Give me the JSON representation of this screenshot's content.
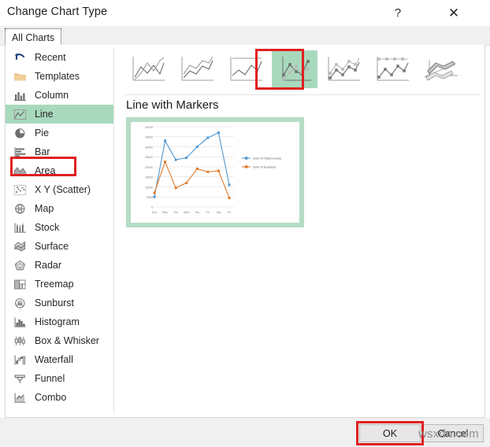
{
  "window": {
    "title": "Change Chart Type",
    "help_label": "?",
    "close_label": "✕"
  },
  "tabs": [
    {
      "label": "All Charts",
      "active": true
    }
  ],
  "sidebar": {
    "items": [
      {
        "label": "Recent",
        "icon": "undo-arrow-icon",
        "selected": false
      },
      {
        "label": "Templates",
        "icon": "folder-icon",
        "selected": false
      },
      {
        "label": "Column",
        "icon": "column-chart-icon",
        "selected": false
      },
      {
        "label": "Line",
        "icon": "line-chart-icon",
        "selected": true
      },
      {
        "label": "Pie",
        "icon": "pie-chart-icon",
        "selected": false
      },
      {
        "label": "Bar",
        "icon": "bar-chart-icon",
        "selected": false
      },
      {
        "label": "Area",
        "icon": "area-chart-icon",
        "selected": false
      },
      {
        "label": "X Y (Scatter)",
        "icon": "scatter-chart-icon",
        "selected": false
      },
      {
        "label": "Map",
        "icon": "map-chart-icon",
        "selected": false
      },
      {
        "label": "Stock",
        "icon": "stock-chart-icon",
        "selected": false
      },
      {
        "label": "Surface",
        "icon": "surface-chart-icon",
        "selected": false
      },
      {
        "label": "Radar",
        "icon": "radar-chart-icon",
        "selected": false
      },
      {
        "label": "Treemap",
        "icon": "treemap-chart-icon",
        "selected": false
      },
      {
        "label": "Sunburst",
        "icon": "sunburst-chart-icon",
        "selected": false
      },
      {
        "label": "Histogram",
        "icon": "histogram-icon",
        "selected": false
      },
      {
        "label": "Box & Whisker",
        "icon": "box-whisker-icon",
        "selected": false
      },
      {
        "label": "Waterfall",
        "icon": "waterfall-icon",
        "selected": false
      },
      {
        "label": "Funnel",
        "icon": "funnel-icon",
        "selected": false
      },
      {
        "label": "Combo",
        "icon": "combo-chart-icon",
        "selected": false
      }
    ]
  },
  "gallery": {
    "thumbnails": [
      {
        "name": "line",
        "selected": false
      },
      {
        "name": "stacked-line",
        "selected": false
      },
      {
        "name": "100-percent-stacked-line",
        "selected": false
      },
      {
        "name": "line-with-markers",
        "selected": true
      },
      {
        "name": "stacked-line-with-markers",
        "selected": false
      },
      {
        "name": "100-percent-stacked-line-markers",
        "selected": false
      },
      {
        "name": "3d-line",
        "selected": false
      }
    ],
    "selected_index": 3
  },
  "preview": {
    "title": "Line with Markers"
  },
  "footer": {
    "ok_label": "OK",
    "cancel_label": "Cancel"
  },
  "watermark": {
    "text": "wsxdn.com"
  },
  "colors": {
    "selection_green": "#a9d9bd",
    "annotation_red": "#e02020",
    "series_blue": "#4f97d0",
    "series_orange": "#e2792a",
    "preview_border": "#b6dcc5"
  },
  "chart_data": {
    "type": "line",
    "title": "Line with Markers",
    "xlabel": "",
    "ylabel": "",
    "grid": true,
    "legend_position": "right",
    "markers": true,
    "categories": [
      "Sun",
      "Mon",
      "Tue",
      "Wed",
      "Thu",
      "Fri",
      "Sat",
      "Fri"
    ],
    "ylim": [
      0,
      40000
    ],
    "yticks": [
      0,
      5000,
      10000,
      15000,
      20000,
      25000,
      30000,
      35000,
      40000
    ],
    "ytick_labels": [
      "0",
      "5000",
      "10000",
      "15000",
      "20000",
      "25000",
      "30000",
      "35000",
      "40000"
    ],
    "series": [
      {
        "name": "Sum of Total Income",
        "color": "#4f97d0",
        "values": [
          5000,
          33000,
          23500,
          24500,
          30000,
          34500,
          37000,
          11000
        ]
      },
      {
        "name": "Sum of Expense",
        "color": "#e2792a",
        "values": [
          7000,
          22500,
          9500,
          12000,
          19000,
          17500,
          18000,
          4500
        ]
      }
    ]
  }
}
